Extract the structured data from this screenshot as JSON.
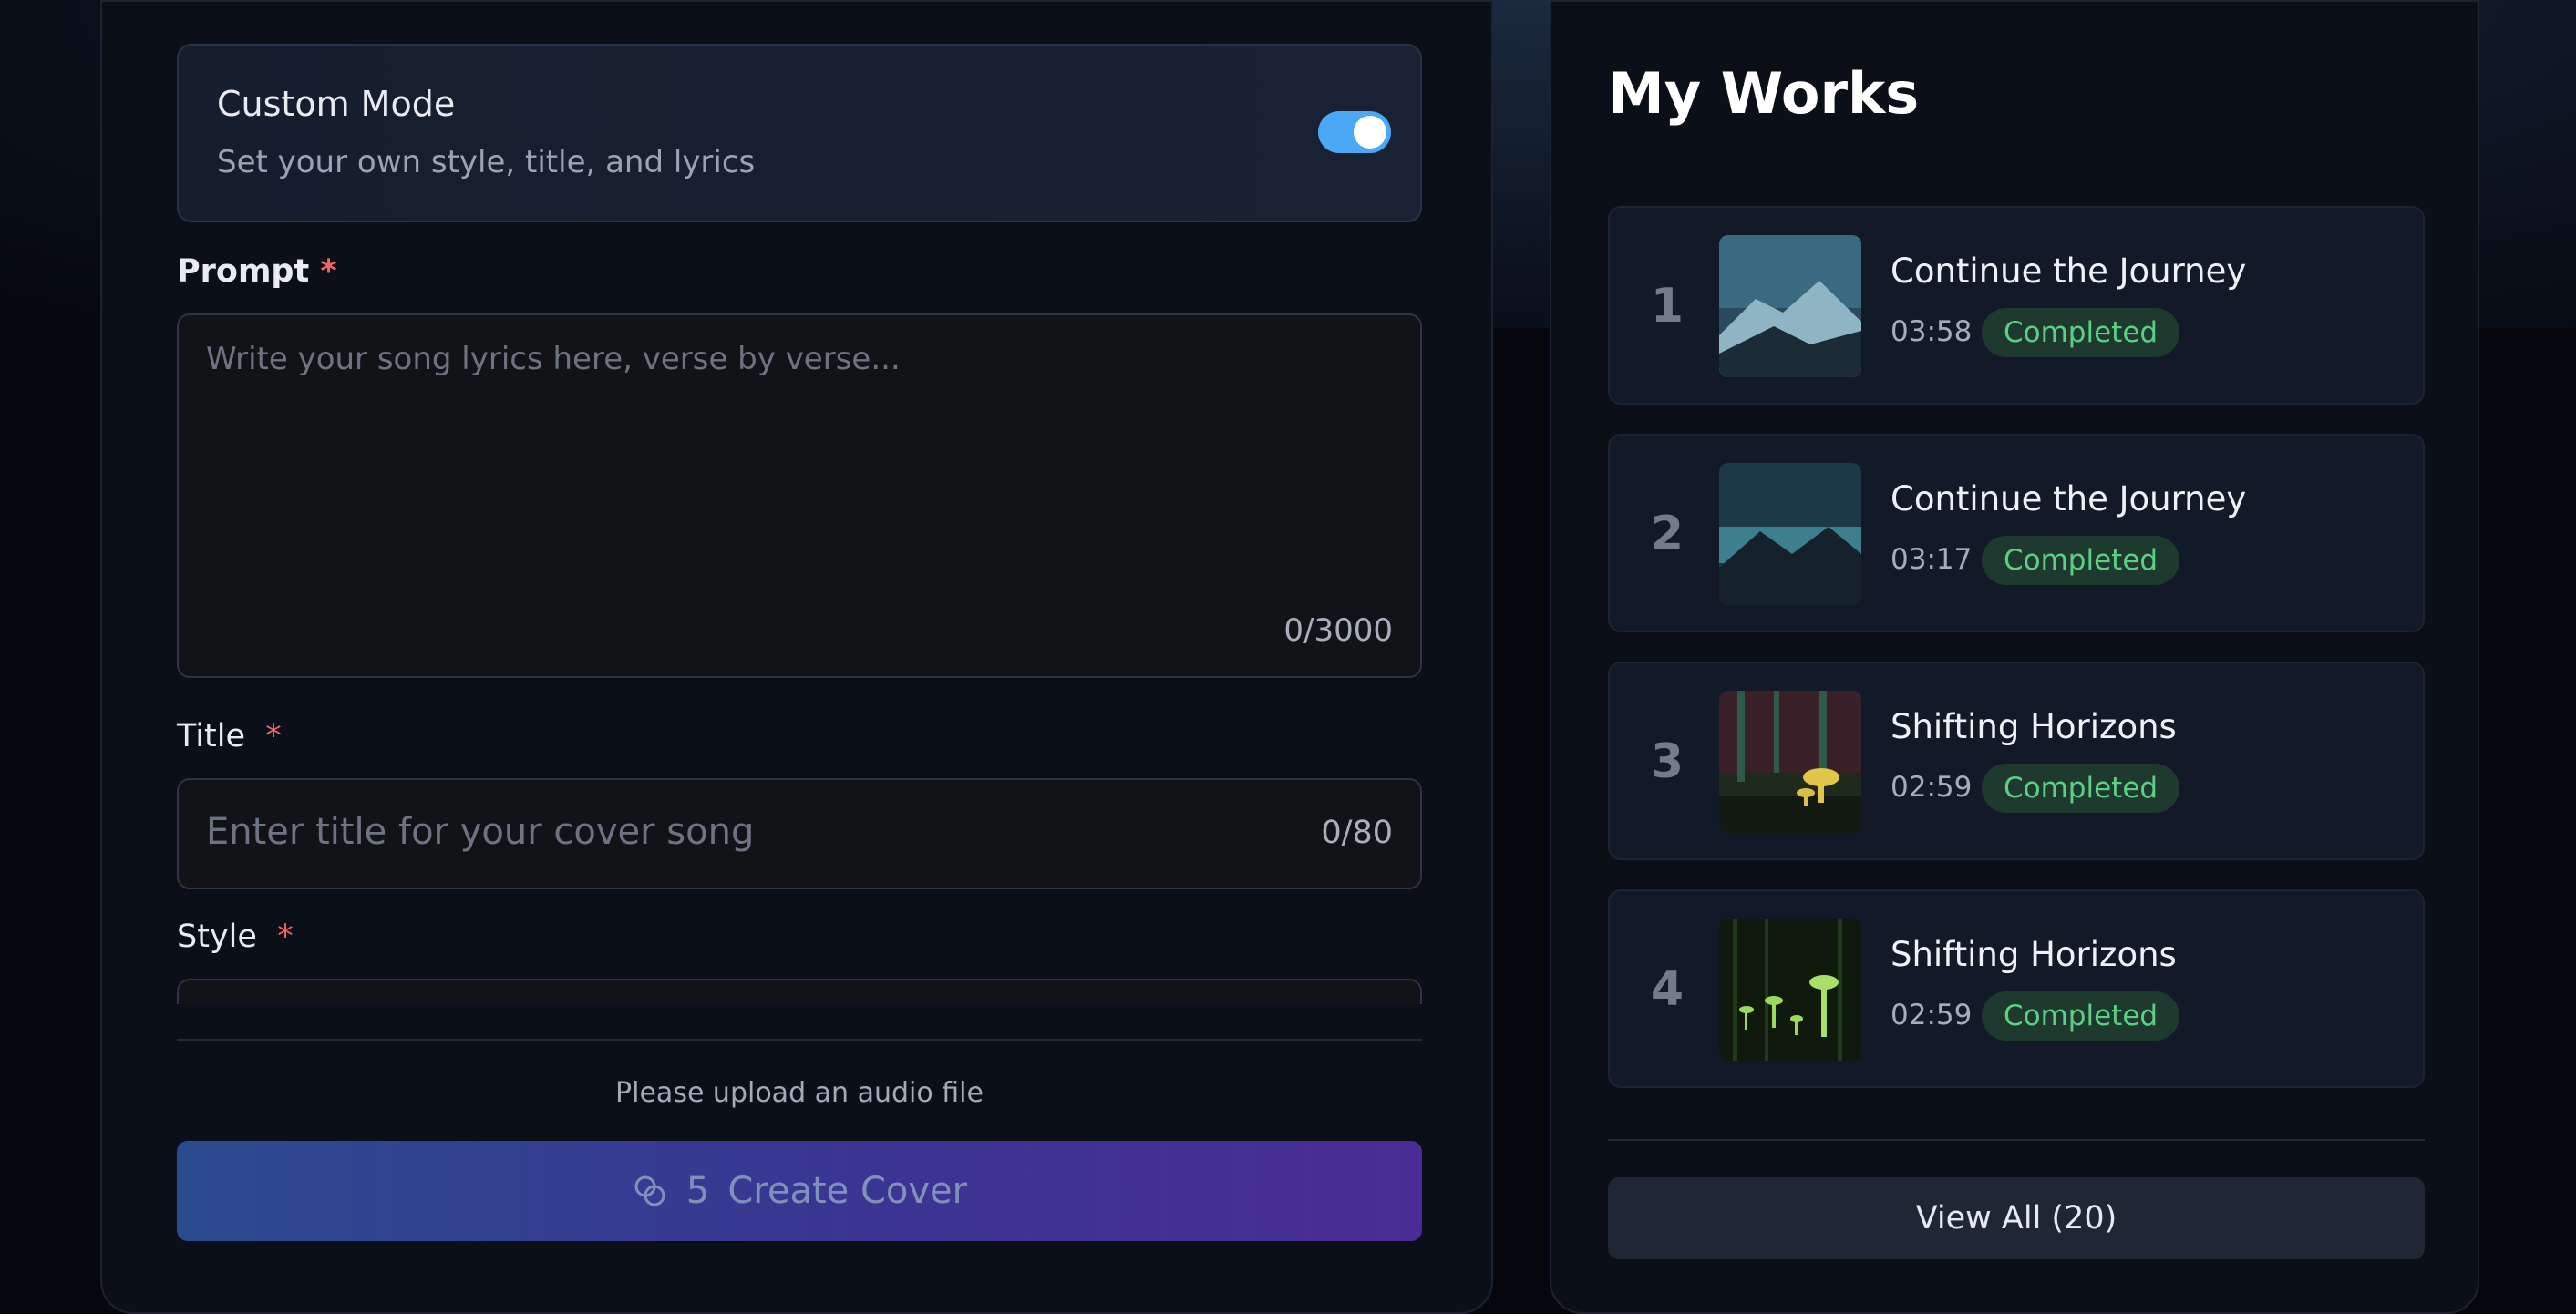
{
  "left_panel": {
    "custom_mode": {
      "title": "Custom Mode",
      "subtitle": "Set your own style, title, and lyrics",
      "enabled": true
    },
    "prompt": {
      "label": "Prompt",
      "required_mark": "*",
      "placeholder": "Write your song lyrics here, verse by verse...",
      "counter": "0/3000"
    },
    "title_field": {
      "label": "Title",
      "required_mark": "*",
      "placeholder": "Enter title for your cover song",
      "counter": "0/80"
    },
    "style_field": {
      "label": "Style",
      "required_mark": "*"
    },
    "upload_note": "Please upload an audio file",
    "create_button": {
      "credits": "5",
      "label": "Create Cover",
      "icon": "coins-icon"
    }
  },
  "right_panel": {
    "title": "My Works",
    "works": [
      {
        "index": "1",
        "name": "Continue the Journey",
        "duration": "03:58",
        "status": "Completed",
        "thumb": "mountain-night"
      },
      {
        "index": "2",
        "name": "Continue the Journey",
        "duration": "03:17",
        "status": "Completed",
        "thumb": "mountain-dusk"
      },
      {
        "index": "3",
        "name": "Shifting Horizons",
        "duration": "02:59",
        "status": "Completed",
        "thumb": "mushroom-forest-red"
      },
      {
        "index": "4",
        "name": "Shifting Horizons",
        "duration": "02:59",
        "status": "Completed",
        "thumb": "mushroom-forest-green"
      }
    ],
    "view_all_label": "View All (20)"
  },
  "colors": {
    "accent_toggle": "#4aa8f5",
    "status_completed": "#5ccf84",
    "required": "#f06464",
    "button_gradient_start": "#2b4a8f",
    "button_gradient_end": "#4a2d94"
  }
}
